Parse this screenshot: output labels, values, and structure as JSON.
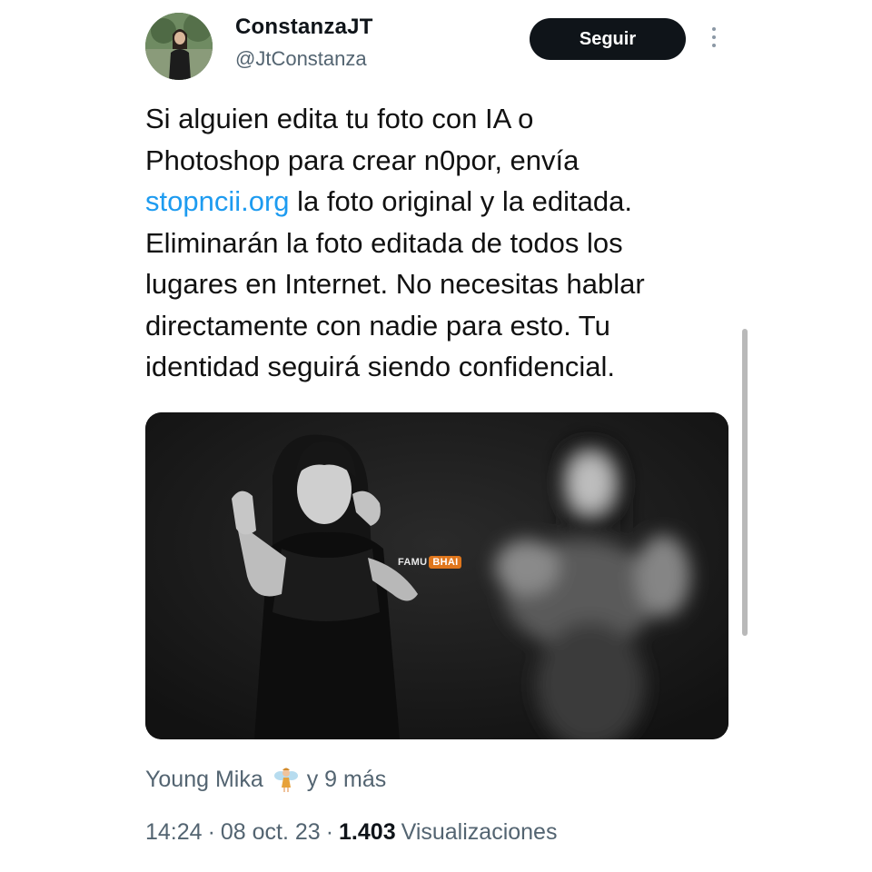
{
  "author": {
    "display_name": "ConstanzaJT",
    "handle": "@JtConstanza",
    "follow_label": "Seguir",
    "avatar_icon": "profile-photo",
    "more_icon": "vertical-dots-icon"
  },
  "tweet": {
    "lines": [
      "Si alguien edita tu foto con IA o",
      "Photoshop para crear n0por, envía",
      "stopncii.org",
      " la foto original y la editada.",
      "Eliminarán la foto editada de todos los",
      "lugares en Internet. No necesitas hablar",
      "directamente con nadie para esto. Tu",
      "identidad seguirá siendo confidencial."
    ],
    "link_color": "#1d9bf0"
  },
  "media": {
    "watermark_a": "FAMU",
    "watermark_b": "BHAI"
  },
  "engagement": {
    "liker": "Young Mika",
    "liker_emoji": "fairy-icon",
    "others": "y 9 más"
  },
  "meta": {
    "time": "14:24",
    "separator": "·",
    "date": "08 oct. 23",
    "views_count": "1.403",
    "views_label": "Visualizaciones"
  }
}
